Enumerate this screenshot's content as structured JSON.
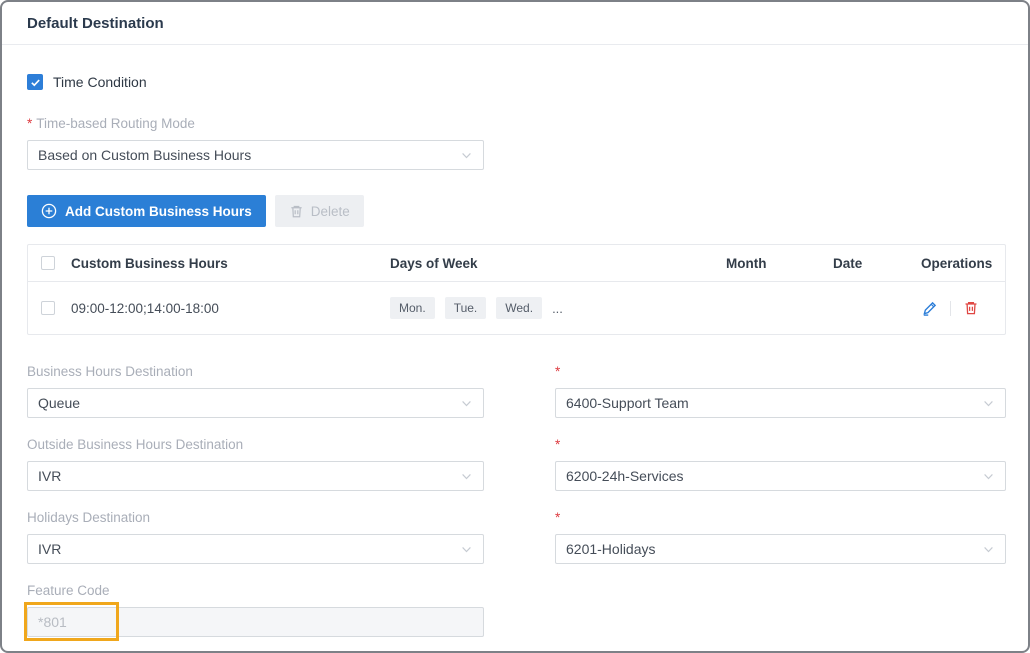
{
  "page": {
    "title": "Default Destination"
  },
  "colors": {
    "accent_blue": "#2b7fd6",
    "danger_red": "#e04743",
    "highlight_orange": "#f0a71c"
  },
  "time_condition": {
    "label": "Time Condition",
    "checked": true
  },
  "routing_mode": {
    "required_mark": "*",
    "label": "Time-based Routing Mode",
    "value": "Based on Custom Business Hours"
  },
  "toolbar": {
    "add_button": "Add Custom Business Hours",
    "delete_button": "Delete"
  },
  "business_hours_table": {
    "columns": {
      "hours": "Custom Business Hours",
      "days": "Days of Week",
      "month": "Month",
      "date": "Date",
      "operations": "Operations"
    },
    "rows": [
      {
        "hours": "09:00-12:00;14:00-18:00",
        "days": [
          "Mon.",
          "Tue.",
          "Wed."
        ],
        "days_overflow": "..."
      }
    ]
  },
  "destinations": [
    {
      "label": "Business Hours Destination",
      "required_mark": "*",
      "type_value": "Queue",
      "target_value": "6400-Support Team"
    },
    {
      "label": "Outside Business Hours Destination",
      "required_mark": "*",
      "type_value": "IVR",
      "target_value": "6200-24h-Services"
    },
    {
      "label": "Holidays Destination",
      "required_mark": "*",
      "type_value": "IVR",
      "target_value": "6201-Holidays"
    }
  ],
  "feature_code": {
    "label": "Feature Code",
    "placeholder": "*801"
  }
}
